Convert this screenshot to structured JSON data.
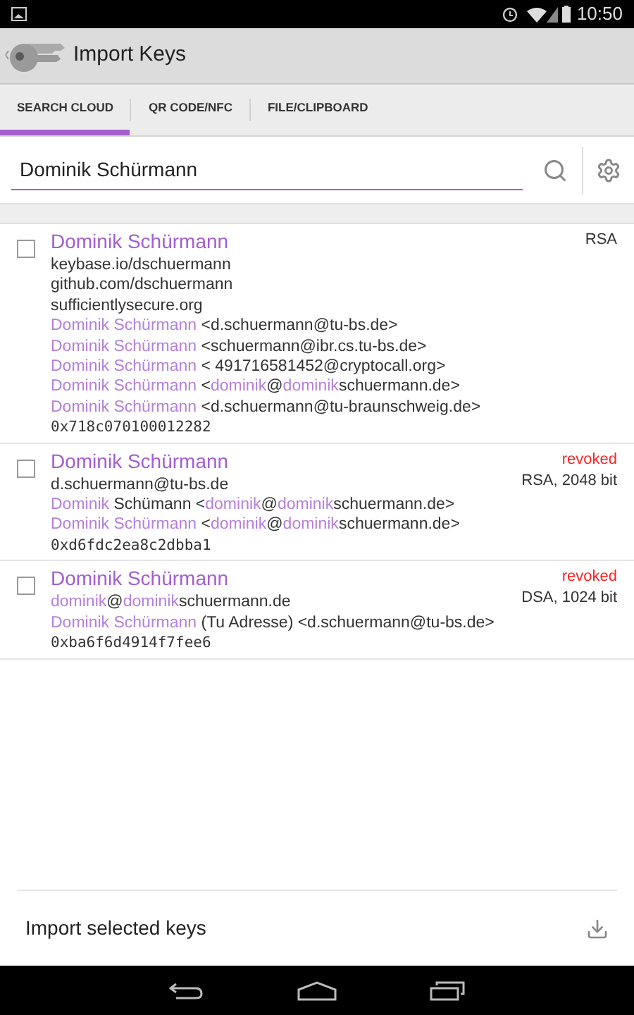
{
  "status_bar": {
    "time": "10:50"
  },
  "action_bar": {
    "title": "Import Keys"
  },
  "tabs": [
    {
      "label": "SEARCH CLOUD",
      "selected": true
    },
    {
      "label": "QR CODE/NFC",
      "selected": false
    },
    {
      "label": "FILE/CLIPBOARD",
      "selected": false
    }
  ],
  "search": {
    "value": "Dominik Schürmann"
  },
  "keys": [
    {
      "checked": false,
      "name": "Dominik Schürmann",
      "revoked": false,
      "algorithm": "RSA",
      "user_ids": [
        [
          {
            "text": "keybase.io/dschuermann",
            "highlight": false
          }
        ],
        [
          {
            "text": "github.com/dschuermann",
            "highlight": false
          }
        ],
        [
          {
            "text": "sufficientlysecure.org",
            "highlight": false
          }
        ],
        [
          {
            "text": "Dominik Schürmann",
            "highlight": true
          },
          {
            "text": " <d.schuermann@tu-bs.de>",
            "highlight": false
          }
        ],
        [
          {
            "text": "Dominik Schürmann",
            "highlight": true
          },
          {
            "text": " <schuermann@ibr.cs.tu-bs.de>",
            "highlight": false
          }
        ],
        [
          {
            "text": "Dominik Schürmann",
            "highlight": true
          },
          {
            "text": " < 491716581452@cryptocall.org>",
            "highlight": false
          }
        ],
        [
          {
            "text": "Dominik Schürmann",
            "highlight": true
          },
          {
            "text": " <",
            "highlight": false
          },
          {
            "text": "dominik",
            "highlight": true
          },
          {
            "text": "@",
            "highlight": false
          },
          {
            "text": "dominik",
            "highlight": true
          },
          {
            "text": "schuermann.de>",
            "highlight": false
          }
        ],
        [
          {
            "text": "Dominik Schürmann",
            "highlight": true
          },
          {
            "text": " <d.schuermann@tu-braunschweig.de>",
            "highlight": false
          }
        ]
      ],
      "key_id": "0x718c070100012282"
    },
    {
      "checked": false,
      "name": "Dominik Schürmann",
      "revoked": true,
      "revoked_label": "revoked",
      "algorithm": "RSA, 2048 bit",
      "user_ids": [
        [
          {
            "text": "d.schuermann@tu-bs.de",
            "highlight": false
          }
        ],
        [
          {
            "text": "Dominik",
            "highlight": true
          },
          {
            "text": " Schümann <",
            "highlight": false
          },
          {
            "text": "dominik",
            "highlight": true
          },
          {
            "text": "@",
            "highlight": false
          },
          {
            "text": "dominik",
            "highlight": true
          },
          {
            "text": "schuermann.de>",
            "highlight": false
          }
        ],
        [
          {
            "text": "Dominik Schürmann",
            "highlight": true
          },
          {
            "text": " <",
            "highlight": false
          },
          {
            "text": "dominik",
            "highlight": true
          },
          {
            "text": "@",
            "highlight": false
          },
          {
            "text": "dominik",
            "highlight": true
          },
          {
            "text": "schuermann.de>",
            "highlight": false
          }
        ]
      ],
      "key_id": "0xd6fdc2ea8c2dbba1"
    },
    {
      "checked": false,
      "name": "Dominik Schürmann",
      "revoked": true,
      "revoked_label": "revoked",
      "algorithm": "DSA, 1024 bit",
      "user_ids": [
        [
          {
            "text": "dominik",
            "highlight": true
          },
          {
            "text": "@",
            "highlight": false
          },
          {
            "text": "dominik",
            "highlight": true
          },
          {
            "text": "schuermann.de",
            "highlight": false
          }
        ],
        [
          {
            "text": "Dominik Schürmann",
            "highlight": true
          },
          {
            "text": " (Tu Adresse) <d.schuermann@tu-bs.de>",
            "highlight": false
          }
        ]
      ],
      "key_id": "0xba6f6d4914f7fee6"
    }
  ],
  "footer": {
    "label": "Import selected keys"
  }
}
